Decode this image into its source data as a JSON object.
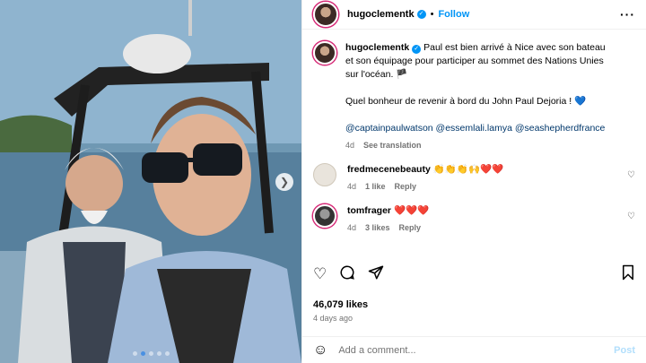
{
  "post": {
    "author": "hugoclementk",
    "follow_label": "Follow",
    "separator": "•",
    "more_label": "···",
    "caption_line1": "Paul est bien arrivé à Nice avec son bateau et son équipage pour participer au sommet des Nations Unies sur l'océan. 🏴",
    "caption_line2": "Quel bonheur de revenir à bord du John Paul Dejoria ! 💙",
    "mentions": "@captainpaulwatson @essemlali.lamya @seashepherdfrance",
    "caption_time": "4d",
    "see_translation": "See translation"
  },
  "comments": [
    {
      "user": "fredmecenebeauty",
      "text": "👏👏👏🙌❤️❤️",
      "time": "4d",
      "likes": "1 like",
      "reply": "Reply"
    },
    {
      "user": "tomfrager",
      "text": "❤️❤️❤️",
      "time": "4d",
      "likes": "3 likes",
      "reply": "Reply"
    }
  ],
  "stats": {
    "likes": "46,079 likes",
    "ago": "4 days ago"
  },
  "add_comment": {
    "placeholder": "Add a comment...",
    "post_label": "Post"
  },
  "icons": {
    "heart": "heart-icon",
    "comment": "comment-icon",
    "share": "share-icon",
    "save": "bookmark-icon",
    "emoji": "emoji-icon",
    "next": "chevron-right-icon"
  },
  "colors": {
    "accent": "#0095f6",
    "link": "#00376b",
    "muted": "#737373",
    "post_disabled": "#b2dffc"
  },
  "carousel": {
    "count": 5,
    "active": 2
  }
}
